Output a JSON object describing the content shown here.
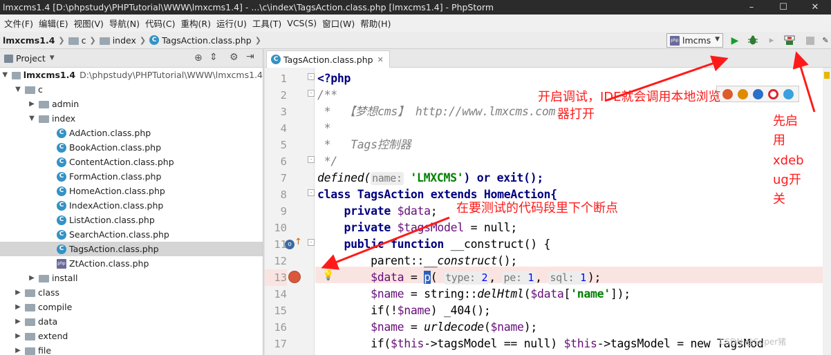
{
  "window": {
    "title": "lmxcms1.4 [D:\\phpstudy\\PHPTutorial\\WWW\\lmxcms1.4] - ...\\c\\index\\TagsAction.class.php [lmxcms1.4] - PhpStorm",
    "minimize": "–",
    "maximize": "☐",
    "close": "✕"
  },
  "menu": [
    "文件(F)",
    "编辑(E)",
    "视图(V)",
    "导航(N)",
    "代码(C)",
    "重构(R)",
    "运行(U)",
    "工具(T)",
    "VCS(S)",
    "窗口(W)",
    "帮助(H)"
  ],
  "breadcrumb": [
    "lmxcms1.4",
    "c",
    "index",
    "TagsAction.class.php"
  ],
  "run_config": "lmcms",
  "project_panel": {
    "title": "Project"
  },
  "tree": [
    {
      "label": "lmxcms1.4",
      "path": "D:\\phpstudy\\PHPTutorial\\WWW\\lmxcms1.4"
    },
    {
      "label": "c"
    },
    {
      "label": "admin"
    },
    {
      "label": "index"
    },
    {
      "label": "AdAction.class.php"
    },
    {
      "label": "BookAction.class.php"
    },
    {
      "label": "ContentAction.class.php"
    },
    {
      "label": "FormAction.class.php"
    },
    {
      "label": "HomeAction.class.php"
    },
    {
      "label": "IndexAction.class.php"
    },
    {
      "label": "ListAction.class.php"
    },
    {
      "label": "SearchAction.class.php"
    },
    {
      "label": "TagsAction.class.php"
    },
    {
      "label": "ZtAction.class.php"
    },
    {
      "label": "install"
    },
    {
      "label": "class"
    },
    {
      "label": "compile"
    },
    {
      "label": "data"
    },
    {
      "label": "extend"
    },
    {
      "label": "file"
    }
  ],
  "editor": {
    "tab": "TagsAction.class.php",
    "line_numbers": [
      "1",
      "2",
      "3",
      "4",
      "5",
      "6",
      "7",
      "8",
      "9",
      "10",
      "11",
      "12",
      "13",
      "14",
      "15",
      "16",
      "17"
    ],
    "breakpoint_line": "13"
  },
  "code": {
    "l1": "<?php",
    "l2": "/**",
    "l3": " *  【梦想cms】 http://www.lmxcms.com",
    "l4": " *",
    "l5": " *   Tags控制器",
    "l6": " */",
    "l7a": "defined(",
    "l7h": "name:",
    "l7s": "'LMXCMS'",
    "l7b": ") or exit();",
    "l8": "class TagsAction extends HomeAction{",
    "l9a": "    private ",
    "l9v": "$data",
    "l9b": ";",
    "l10a": "    private ",
    "l10v": "$tagsModel",
    "l10b": " = null;",
    "l11a": "    public function ",
    "l11b": "__construct() {",
    "l12a": "        parent::",
    "l12b": "__construct",
    "l12c": "();",
    "l13v": "$data",
    "l13a": " = ",
    "l13p": "p",
    "l13h1": "type:",
    "l13n1": "2",
    "l13h2": "pe:",
    "l13n2": "1",
    "l13h3": "sql:",
    "l13n3": "1",
    "l13z": ");",
    "l14v": "$name",
    "l14a": " = string::",
    "l14f": "delHtml",
    "l14b": "(",
    "l14v2": "$data",
    "l14s": "'name'",
    "l14c": "]);",
    "l15a": "        if(!",
    "l15v": "$name",
    "l15b": ") _404();",
    "l16v": "$name",
    "l16a": " = ",
    "l16f": "urldecode",
    "l16b": "(",
    "l16v2": "$name",
    "l16c": ");",
    "l17a": "        if(",
    "l17v": "$this",
    "l17b": "->tagsModel == null) ",
    "l17v2": "$this",
    "l17c": "->tagsModel = new TagsMod"
  },
  "annotations": {
    "debug_note_1": "开启调试，IDE就会调用本地浏览",
    "debug_note_2": "器打开",
    "xdebug_note": [
      "先启",
      "用",
      "xdeb",
      "ug开",
      "关"
    ],
    "breakpoint_note": "在要测试的代码段里下个断点"
  },
  "watermark": "CSDN @Super猪",
  "colors": {
    "annotation": "#ff1a1a",
    "run": "#1a9c2e",
    "debug": "#2e7d32",
    "breakpoint": "#d9583b",
    "selected_row": "#d5d5d5"
  }
}
